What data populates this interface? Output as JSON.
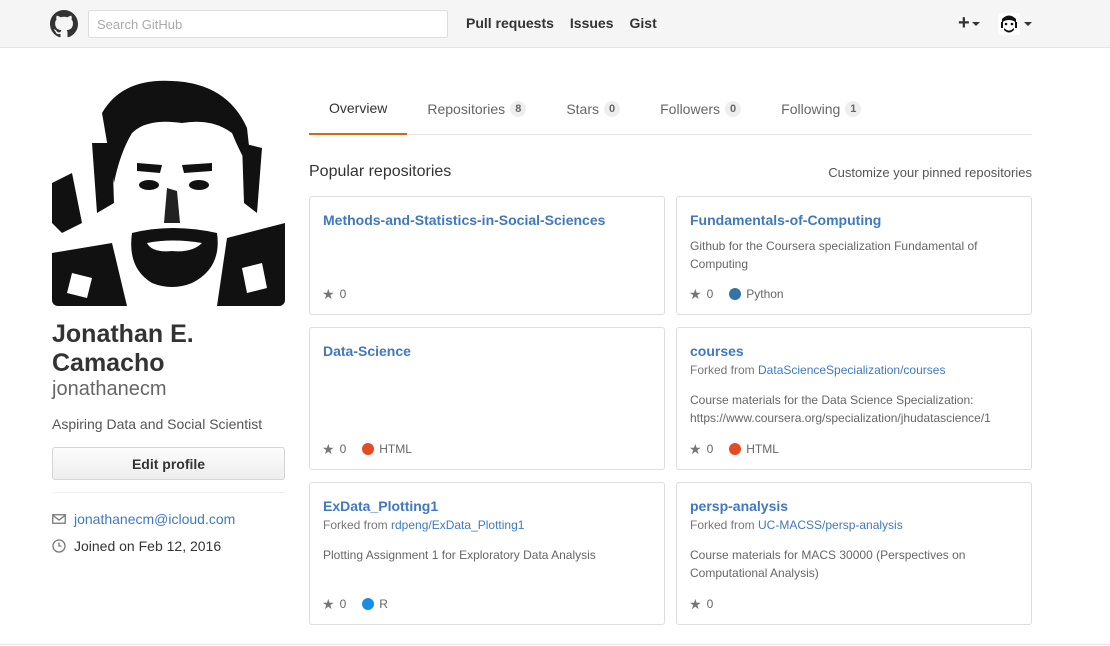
{
  "header": {
    "search_placeholder": "Search GitHub",
    "nav": [
      "Pull requests",
      "Issues",
      "Gist"
    ],
    "plus_label": "+"
  },
  "profile": {
    "name_line1": "Jonathan E.",
    "name_line2": "Camacho",
    "login": "jonathanecm",
    "bio": "Aspiring Data and Social Scientist",
    "edit_button": "Edit profile",
    "email": "jonathanecm@icloud.com",
    "joined": "Joined on Feb 12, 2016"
  },
  "tabs": [
    {
      "label": "Overview",
      "count": null,
      "selected": true
    },
    {
      "label": "Repositories",
      "count": "8"
    },
    {
      "label": "Stars",
      "count": "0"
    },
    {
      "label": "Followers",
      "count": "0"
    },
    {
      "label": "Following",
      "count": "1"
    }
  ],
  "popular": {
    "title": "Popular repositories",
    "customize": "Customize your pinned repositories"
  },
  "repos": [
    {
      "name": "Methods-and-Statistics-in-Social-Sciences",
      "desc": "",
      "stars": "0",
      "lang": "",
      "color": ""
    },
    {
      "name": "Fundamentals-of-Computing",
      "desc": "Github for the Coursera specialization Fundamental of Computing",
      "stars": "0",
      "lang": "Python",
      "color": "#3572A5"
    },
    {
      "name": "Data-Science",
      "desc": "",
      "stars": "0",
      "lang": "HTML",
      "color": "#e44b23"
    },
    {
      "name": "courses",
      "forked_prefix": "Forked from ",
      "forked_from": "DataScienceSpecialization/courses",
      "desc": "Course materials for the Data Science Specialization: https://www.coursera.org/specialization/jhudatascience/1",
      "stars": "0",
      "lang": "HTML",
      "color": "#e44b23"
    },
    {
      "name": "ExData_Plotting1",
      "forked_prefix": "Forked from ",
      "forked_from": "rdpeng/ExData_Plotting1",
      "desc": "Plotting Assignment 1 for Exploratory Data Analysis",
      "stars": "0",
      "lang": "R",
      "color": "#198ce7"
    },
    {
      "name": "persp-analysis",
      "forked_prefix": "Forked from ",
      "forked_from": "UC-MACSS/persp-analysis",
      "desc": "Course materials for MACS 30000 (Perspectives on Computational Analysis)",
      "stars": "0",
      "lang": "",
      "color": ""
    }
  ]
}
